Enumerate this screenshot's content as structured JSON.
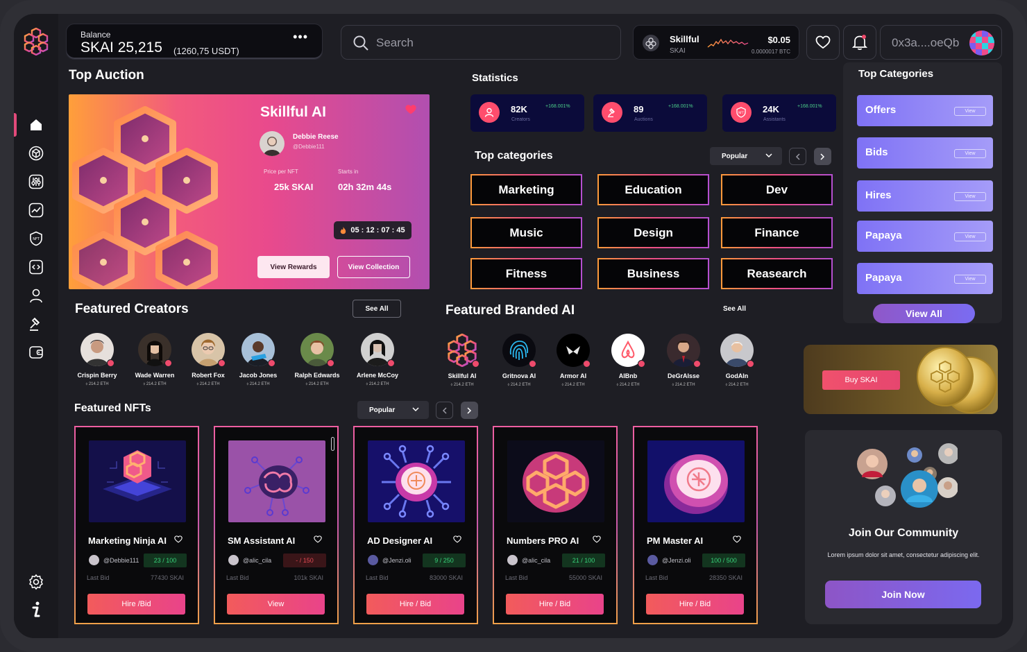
{
  "header": {
    "balance_label": "Balance",
    "balance_amount": "SKAI 25,215",
    "balance_usd": "(1260,75 USDT)",
    "more_icon": "more-dots-icon",
    "search_placeholder": "Search",
    "ticker_name": "Skillful",
    "ticker_symbol": "SKAI",
    "ticker_price": "$0.05",
    "ticker_btc": "0.0000017 BTC",
    "wallet_address": "0x3a....oeQb"
  },
  "auction": {
    "section_title": "Top Auction",
    "title": "Skillful AI",
    "creator_name": "Debbie Reese",
    "creator_handle": "@Debbie111",
    "price_label": "Price per NFT",
    "price_value": "25k SKAI",
    "starts_label": "Starts in",
    "starts_value": "02h 32m 44s",
    "timer": "05 : 12 : 07 : 45",
    "view_rewards": "View Rewards",
    "view_collection": "View Collection"
  },
  "statistics": {
    "title": "Statistics",
    "items": [
      {
        "value": "82K",
        "label": "Creators",
        "change": "+168.001%"
      },
      {
        "value": "89",
        "label": "Auctions",
        "change": "+168.001%"
      },
      {
        "value": "24K",
        "label": "Assistants",
        "change": "+168.001%"
      }
    ]
  },
  "top_categories": {
    "title": "Top categories",
    "filter": "Popular",
    "items": [
      "Marketing",
      "Education",
      "Dev",
      "Music",
      "Design",
      "Finance",
      "Fitness",
      "Business",
      "Reasearch"
    ]
  },
  "right_panel": {
    "title": "Top Categories",
    "view_label": "View",
    "items": [
      "Offers",
      "Bids",
      "Hires",
      "Papaya",
      "Papaya"
    ],
    "view_all": "View All"
  },
  "buy": {
    "label": "Buy SKAI"
  },
  "community": {
    "title": "Join Our Community",
    "description": "Lorem ipsum dolor sit amet, consectetur adipiscing elit.",
    "button": "Join Now"
  },
  "featured_creators": {
    "title": "Featured Creators",
    "see_all": "See All",
    "items": [
      {
        "name": "Crispin Berry",
        "eth": "214.2 ETH"
      },
      {
        "name": "Wade Warren",
        "eth": "214.2 ETH"
      },
      {
        "name": "Robert Fox",
        "eth": "214.2 ETH"
      },
      {
        "name": "Jacob Jones",
        "eth": "214.2 ETH"
      },
      {
        "name": "Ralph Edwards",
        "eth": "214.2 ETH"
      },
      {
        "name": "Arlene McCoy",
        "eth": "214.2 ETH"
      }
    ]
  },
  "featured_branded": {
    "title": "Featured Branded AI",
    "see_all": "See All",
    "items": [
      {
        "name": "Skillful AI",
        "eth": "214.2 ETH"
      },
      {
        "name": "Gritnova AI",
        "eth": "214.2 ETH"
      },
      {
        "name": "Armor AI",
        "eth": "214.2 ETH"
      },
      {
        "name": "AIBnb",
        "eth": "214.2 ETH"
      },
      {
        "name": "DeGrAIsse",
        "eth": "214.2 ETH"
      },
      {
        "name": "GodAIn",
        "eth": "214.2 ETH"
      }
    ]
  },
  "featured_nfts": {
    "title": "Featured NFTs",
    "filter": "Popular",
    "last_bid_label": "Last Bid",
    "items": [
      {
        "name": "Marketing Ninja AI",
        "owner": "@Debbie111",
        "count": "23 / 100",
        "bid": "77430 SKAI",
        "action": "Hire /Bid"
      },
      {
        "name": "SM Assistant AI",
        "owner": "@alic_cila",
        "count": "- / 150",
        "bid": "101k SKAI",
        "action": "View"
      },
      {
        "name": "AD Designer AI",
        "owner": "@Jenzi.oli",
        "count": "9 / 250",
        "bid": "83000 SKAI",
        "action": "Hire / Bid"
      },
      {
        "name": "Numbers PRO AI",
        "owner": "@alic_cila",
        "count": "21 / 100",
        "bid": "55000 SKAI",
        "action": "Hire / Bid"
      },
      {
        "name": "PM Master AI",
        "owner": "@Jenzi.oli",
        "count": "100 / 500",
        "bid": "28350 SKAI",
        "action": "Hire / Bid"
      }
    ]
  }
}
